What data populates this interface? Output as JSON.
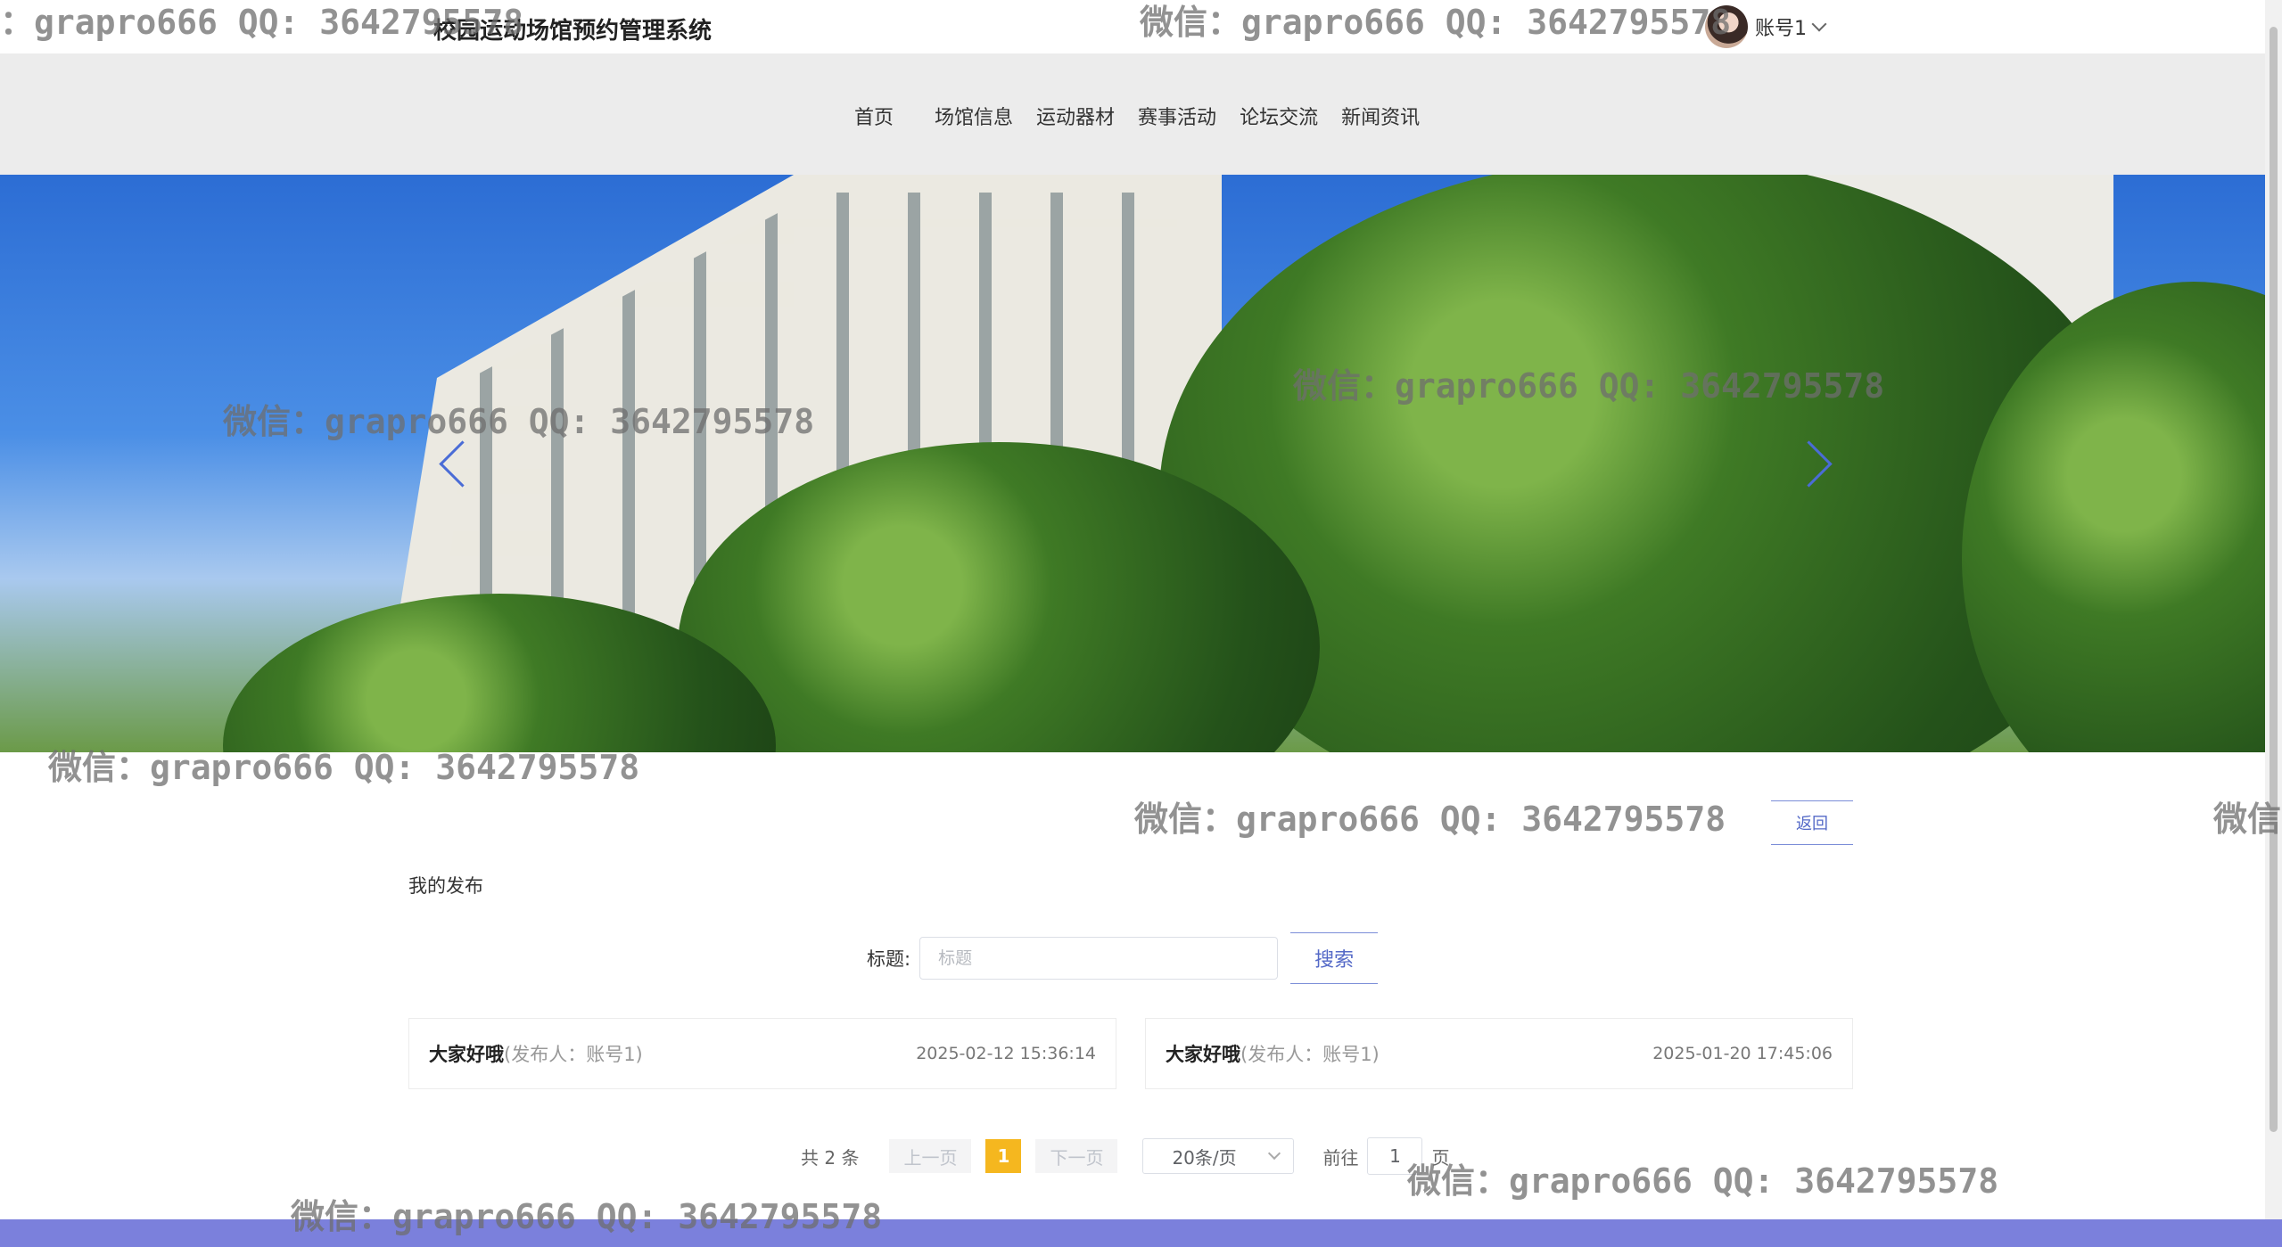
{
  "header": {
    "site_title": "校园运动场馆预约管理系统",
    "user_name": "账号1"
  },
  "nav": {
    "items": [
      "首页",
      "场馆信息",
      "运动器材",
      "赛事活动",
      "论坛交流",
      "新闻资讯"
    ]
  },
  "page": {
    "back_label": "返回",
    "section_title": "我的发布",
    "search_label": "标题:",
    "search_placeholder": "标题",
    "search_button": "搜索"
  },
  "posts": [
    {
      "title": "大家好哦",
      "meta": "(发布人：账号1)",
      "date": "2025-02-12 15:36:14"
    },
    {
      "title": "大家好哦",
      "meta": "(发布人：账号1)",
      "date": "2025-01-20 17:45:06"
    }
  ],
  "pagination": {
    "total": "共 2 条",
    "prev": "上一页",
    "current": "1",
    "next": "下一页",
    "page_size": "20条/页",
    "goto_label": "前往",
    "goto_value": "1",
    "page_suffix": "页"
  },
  "watermarks": [
    "：grapro666 QQ: 3642795578",
    "微信：grapro666 QQ: 3642795578",
    "微信：grapro666 QQ: 3642795578",
    "微信：grapro666 QQ: 3642795578",
    "微信：grapro666 QQ: 3642795578",
    "微信：grapro666 QQ: 3642795578",
    "微信",
    "微信：grapro666 QQ: 3642795578",
    "微信：grapro666 QQ: 3642795578"
  ],
  "colors": {
    "accent": "#5469c7",
    "active_page": "#f5b71f",
    "footer": "#7b80dc",
    "nav_bg": "#ececec"
  }
}
